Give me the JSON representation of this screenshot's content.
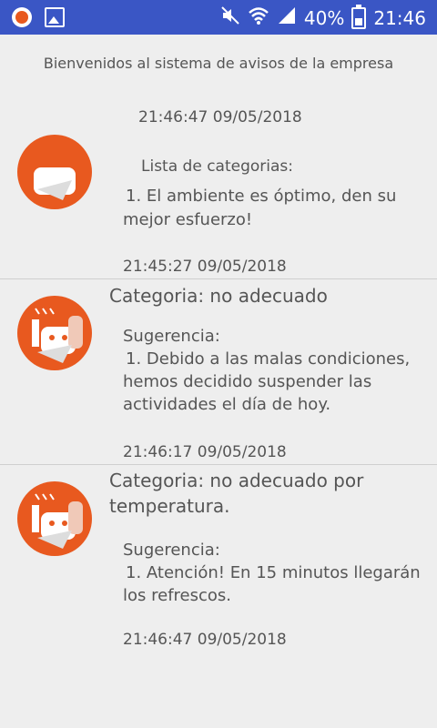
{
  "status_bar": {
    "battery_percent": "40%",
    "time": "21:46",
    "icons": [
      "app-notification-icon",
      "image-icon",
      "mute-icon",
      "wifi-icon",
      "signal-icon",
      "battery-icon"
    ]
  },
  "header": {
    "welcome": "Bienvenidos al sistema de avisos de la empresa",
    "timestamp": "21:46:47 09/05/2018",
    "list_title": "Lista de categorias:"
  },
  "items": [
    {
      "suggestion_line1": "1. El ambiente es óptimo, den su",
      "suggestion_line2": "mejor esfuerzo!",
      "timestamp": "21:45:27 09/05/2018"
    },
    {
      "category_line1": "Categoria: no adecuado",
      "suggestion_label": "Sugerencia:",
      "suggestion_line1": "1. Debido a las malas condiciones,",
      "suggestion_line2": "hemos decidido suspender las",
      "suggestion_line3": "actividades el día de hoy.",
      "timestamp": "21:46:17 09/05/2018"
    },
    {
      "category_line1": "Categoria: no adecuado por",
      "category_line2": "temperatura.",
      "suggestion_label": "Sugerencia:",
      "suggestion_line1": "1. Atención! En 15 minutos llegarán",
      "suggestion_line2": "los refrescos.",
      "timestamp": "21:46:47 09/05/2018"
    }
  ],
  "colors": {
    "status_bar": "#3a56c5",
    "avatar": "#e8591f",
    "background": "#eeeeee"
  }
}
